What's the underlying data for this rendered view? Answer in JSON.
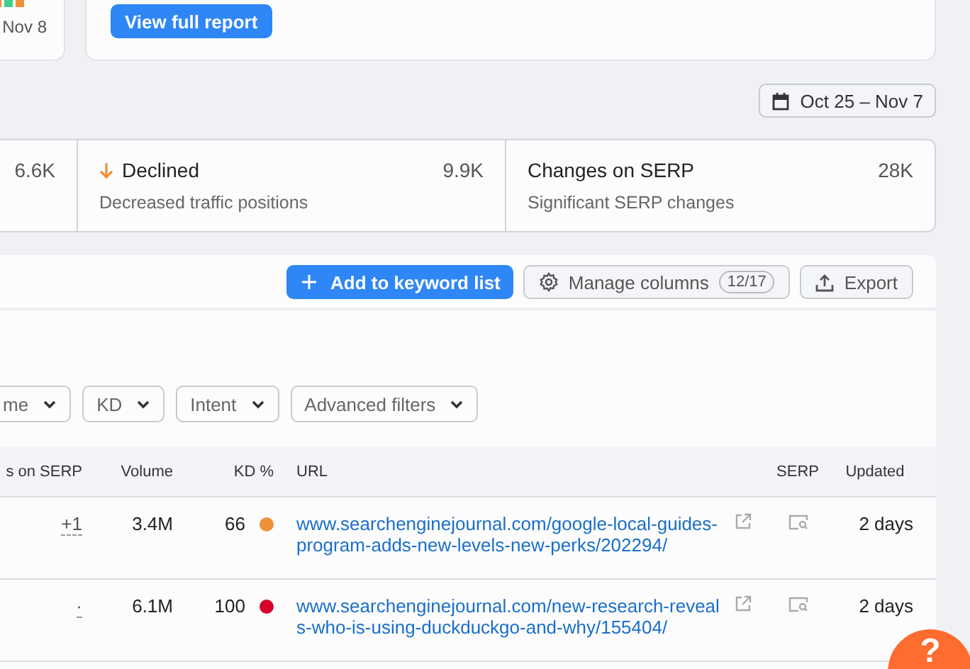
{
  "overview": {
    "chart_label": "Nov 8",
    "report_button": "View full report"
  },
  "date_range": "Oct 25 – Nov 7",
  "stats": [
    {
      "value": "6.6K"
    },
    {
      "decreasing": true,
      "title": "Declined",
      "description": "Decreased traffic positions",
      "value": "9.9K"
    },
    {
      "title": "Changes on SERP",
      "description": "Significant SERP changes",
      "value": "28K"
    }
  ],
  "toolbar": {
    "add_button": "Add to keyword list",
    "manage_button": {
      "label": "Manage columns",
      "count": "12/17"
    },
    "export_button": "Export"
  },
  "filters": [
    "me",
    "KD",
    "Intent",
    "Advanced filters"
  ],
  "table": {
    "columns": [
      "s on SERP",
      "Volume",
      "KD %",
      "URL",
      "SERP",
      "Updated"
    ],
    "rows": [
      {
        "serp_change": "+1",
        "volume": "3.4M",
        "kd": "66",
        "color": "#f0913a",
        "url": "www.searchenginejournal.com/google-local-guides-program-adds-new-levels-new-perks/202294/",
        "updated": "2 days"
      },
      {
        "serp_change": "·",
        "volume": "6.1M",
        "kd": "100",
        "color": "#d6002b",
        "url": "www.searchenginejournal.com/new-research-reveals-who-is-using-duckduckgo-and-why/155404/",
        "updated": "2 days"
      }
    ]
  },
  "help_button": "?"
}
